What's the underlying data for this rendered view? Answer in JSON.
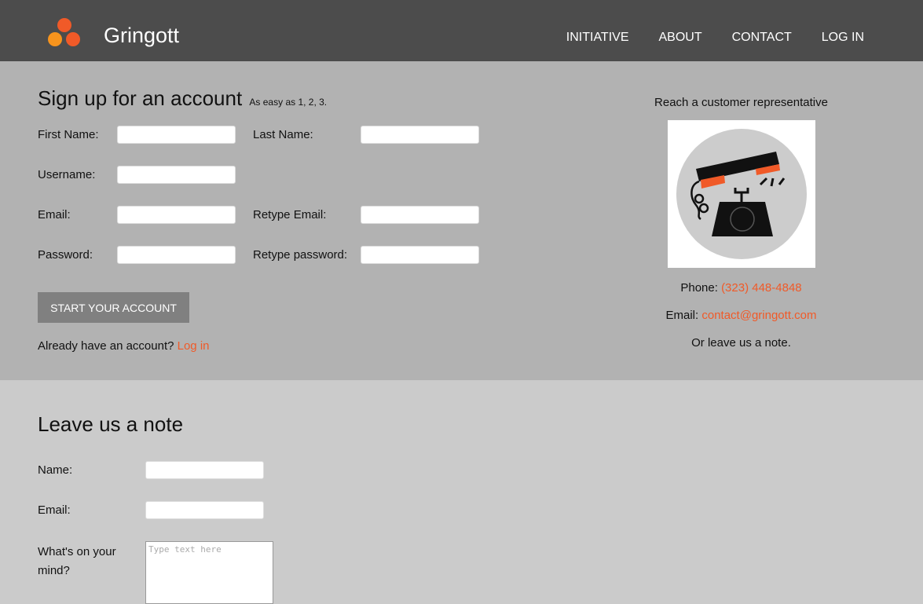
{
  "brand": {
    "name": "Gringott",
    "logo_icon": "three-circles-logo-icon",
    "colors": {
      "orange": "#f05a28",
      "amber": "#f7941d"
    }
  },
  "nav": [
    "INITIATIVE",
    "ABOUT",
    "CONTACT",
    "LOG IN"
  ],
  "signup": {
    "title": "Sign up for an account",
    "subtitle": "As easy as 1, 2, 3.",
    "fields": {
      "first_name": "First Name:",
      "last_name": "Last Name:",
      "username": "Username:",
      "email": "Email:",
      "retype_email": "Retype Email:",
      "password": "Password:",
      "retype_password": "Retype password:"
    },
    "submit": "START YOUR ACCOUNT",
    "existing_prefix": "Already have an account?",
    "login_link": "Log in"
  },
  "contact": {
    "heading": "Reach a customer representative",
    "image_icon": "telephone-icon",
    "phone_label": "Phone:",
    "phone": "(323) 448-4848",
    "email_label": "Email:",
    "email": "contact@gringott.com",
    "note_text": "Or leave us a note."
  },
  "note": {
    "title": "Leave us a note",
    "name_label": "Name:",
    "email_label": "Email:",
    "mind_label_1": "What's on your",
    "mind_label_2": "mind?",
    "mind_placeholder": "Type text here"
  }
}
